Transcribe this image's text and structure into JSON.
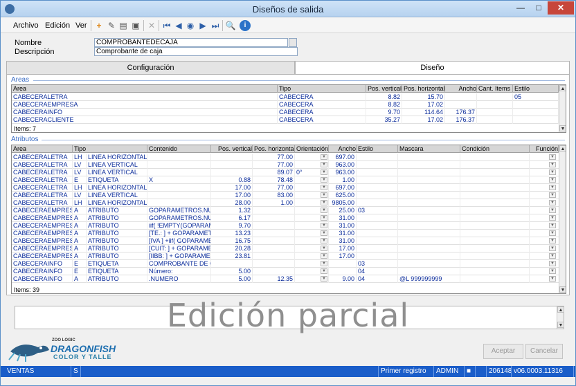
{
  "window": {
    "title": "Diseños de salida"
  },
  "menu": {
    "items": [
      "Archivo",
      "Edición",
      "Ver"
    ]
  },
  "form": {
    "nombre_label": "Nombre",
    "nombre_value": "COMPROBANTEDECAJA",
    "descripcion_label": "Descripción",
    "descripcion_value": "Comprobante de caja"
  },
  "tabs": {
    "configuracion": "Configuración",
    "diseno": "Diseño"
  },
  "areas": {
    "section_title": "Areas",
    "columns": [
      "Area",
      "Tipo",
      "Pos. vertical",
      "Pos. horizontal",
      "Ancho",
      "Cant. Items",
      "Estilo"
    ],
    "rows": [
      [
        "CABECERALETRA",
        "CABECERA",
        "8.82",
        "15.70",
        "",
        "",
        "05"
      ],
      [
        "CABECERAEMPRESA",
        "CABECERA",
        "8.82",
        "17.02",
        "",
        "",
        ""
      ],
      [
        "CABECERAINFO",
        "CABECERA",
        "9.70",
        "114.64",
        "176.37",
        "",
        ""
      ],
      [
        "CABECERACLIENTE",
        "CABECERA",
        "35.27",
        "17.02",
        "176.37",
        "",
        ""
      ]
    ],
    "items_label": "Items: 7"
  },
  "atributos": {
    "section_title": "Atributos",
    "columns": [
      "Area",
      "Tipo",
      "",
      "Contenido",
      "Pos. vertical",
      "Pos. horizontal",
      "Orientación",
      "Ancho",
      "Estilo",
      "Mascara",
      "Condición",
      "Función"
    ],
    "rows": [
      [
        "CABECERALETRA",
        "LH",
        "LINEA HORIZONTAL",
        "",
        "",
        "77.00",
        "",
        "697.00",
        "",
        "",
        ""
      ],
      [
        "CABECERALETRA",
        "LV",
        "LINEA VERTICAL",
        "",
        "",
        "77.00",
        "",
        "963.00",
        "",
        "",
        ""
      ],
      [
        "CABECERALETRA",
        "LV",
        "LINEA VERTICAL",
        "",
        "",
        "89.07",
        "0°",
        "963.00",
        "",
        "",
        ""
      ],
      [
        "CABECERALETRA",
        "E",
        "ETIQUETA",
        "X",
        "0.88",
        "78.48",
        "",
        "1.00",
        "",
        "",
        ""
      ],
      [
        "CABECERALETRA",
        "LH",
        "LINEA HORIZONTAL",
        "",
        "17.00",
        "77.00",
        "",
        "697.00",
        "",
        "",
        ""
      ],
      [
        "CABECERALETRA",
        "LV",
        "LINEA VERTICAL",
        "",
        "17.00",
        "83.00",
        "",
        "625.00",
        "",
        "",
        ""
      ],
      [
        "CABECERALETRA",
        "LH",
        "LINEA HORIZONTAL",
        "",
        "28.00",
        "1.00",
        "",
        "9805.00",
        "",
        "",
        ""
      ],
      [
        "CABECERAEMPRESA",
        "A",
        "ATRIBUTO",
        "GOPARAMETROS.NUCI",
        "1.32",
        "",
        "",
        "25.00",
        "03",
        "",
        ""
      ],
      [
        "CABECERAEMPRESA",
        "A",
        "ATRIBUTO",
        "GOPARAMETROS.NUCI",
        "6.17",
        "",
        "",
        "31.00",
        "",
        "",
        ""
      ],
      [
        "CABECERAEMPRESA",
        "A",
        "ATRIBUTO",
        "iif( !EMPTY(GOPARAME",
        "9.70",
        "",
        "",
        "31.00",
        "",
        "",
        ""
      ],
      [
        "CABECERAEMPRESA",
        "A",
        "ATRIBUTO",
        "[TE.: ] + GOPARAMETI",
        "13.23",
        "",
        "",
        "31.00",
        "",
        "",
        ""
      ],
      [
        "CABECERAEMPRESA",
        "A",
        "ATRIBUTO",
        "[IVA ] +iif( GOPARAME",
        "16.75",
        "",
        "",
        "31.00",
        "",
        "",
        ""
      ],
      [
        "CABECERAEMPRESA",
        "A",
        "ATRIBUTO",
        "[CUIT: ] + GOPARAME",
        "20.28",
        "",
        "",
        "17.00",
        "",
        "",
        ""
      ],
      [
        "CABECERAEMPRESA",
        "A",
        "ATRIBUTO",
        "[IIBB: ] + GOPARAME",
        "23.81",
        "",
        "",
        "17.00",
        "",
        "",
        ""
      ],
      [
        "CABECERAINFO",
        "E",
        "ETIQUETA",
        "COMPROBANTE DE CAJA",
        "",
        "",
        "",
        "",
        "03",
        "",
        ""
      ],
      [
        "CABECERAINFO",
        "E",
        "ETIQUETA",
        "Número:",
        "5.00",
        "",
        "",
        "",
        "04",
        "",
        ""
      ],
      [
        "CABECERAINFO",
        "A",
        "ATRIBUTO",
        ".NUMERO",
        "5.00",
        "12.35",
        "",
        "9.00",
        "04",
        "@L 999999999",
        ""
      ]
    ],
    "items_label": "Items: 39"
  },
  "watermark": "Edición parcial",
  "logo": {
    "brand_top": "ZOO LOGIC",
    "brand_name": "DRAGONFISH",
    "brand_sub": "COLOR Y TALLE"
  },
  "buttons": {
    "aceptar": "Aceptar",
    "cancelar": "Cancelar"
  },
  "status": {
    "modulo": "VENTAS",
    "s": "S",
    "registro": "Primer registro",
    "usuario": "ADMIN",
    "codigo": "206148",
    "version": "v06.0003.11316"
  }
}
